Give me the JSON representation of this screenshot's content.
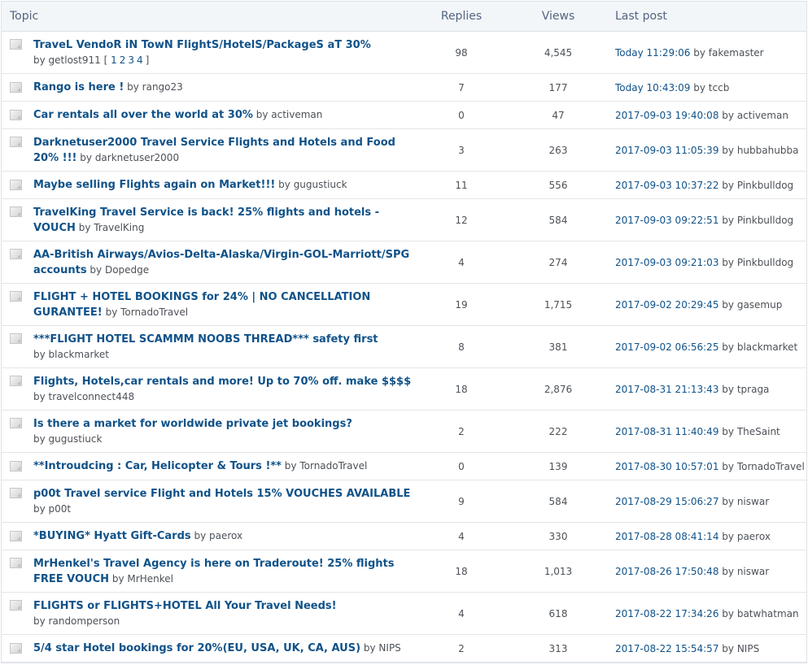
{
  "header": {
    "topic": "Topic",
    "replies": "Replies",
    "views": "Views",
    "last_post": "Last post"
  },
  "by_label": "by",
  "topics": [
    {
      "title": "TraveL VendoR iN TowN FlightS/HotelS/PackageS aT 30%",
      "title2": "",
      "author": "getlost911",
      "pages": [
        "1",
        "2",
        "3",
        "4"
      ],
      "replies": "98",
      "views": "4,545",
      "last_time": "Today 11:29:06",
      "last_user": "fakemaster"
    },
    {
      "title": "Rango is here !",
      "title2": "",
      "author": "rango23",
      "pages": [],
      "replies": "7",
      "views": "177",
      "last_time": "Today 10:43:09",
      "last_user": "tccb"
    },
    {
      "title": "Car rentals all over the world at 30%",
      "title2": "",
      "author": "activeman",
      "pages": [],
      "replies": "0",
      "views": "47",
      "last_time": "2017-09-03 19:40:08",
      "last_user": "activeman"
    },
    {
      "title": "Darknetuser2000 Travel Service Flights and Hotels and Food",
      "title2": "20% !!!",
      "author": "darknetuser2000",
      "pages": [],
      "replies": "3",
      "views": "263",
      "last_time": "2017-09-03 11:05:39",
      "last_user": "hubbahubba"
    },
    {
      "title": "Maybe selling Flights again on Market!!!",
      "title2": "",
      "author": "gugustiuck",
      "pages": [],
      "replies": "11",
      "views": "556",
      "last_time": "2017-09-03 10:37:22",
      "last_user": "Pinkbulldog"
    },
    {
      "title": "TravelKing Travel Service is back! 25% flights and hotels -",
      "title2": "VOUCH",
      "author": "TravelKing",
      "pages": [],
      "replies": "12",
      "views": "584",
      "last_time": "2017-09-03 09:22:51",
      "last_user": "Pinkbulldog"
    },
    {
      "title": "AA-British Airways/Avios-Delta-Alaska/Virgin-GOL-Marriott/SPG",
      "title2": "accounts",
      "author": "Dopedge",
      "pages": [],
      "replies": "4",
      "views": "274",
      "last_time": "2017-09-03 09:21:03",
      "last_user": "Pinkbulldog"
    },
    {
      "title": "FLIGHT + HOTEL BOOKINGS for 24% | NO CANCELLATION",
      "title2": "GURANTEE!",
      "author": "TornadoTravel",
      "pages": [],
      "replies": "19",
      "views": "1,715",
      "last_time": "2017-09-02 20:29:45",
      "last_user": "gasemup"
    },
    {
      "title": "***FLIGHT HOTEL SCAMMM NOOBS THREAD*** safety first",
      "title2": "",
      "author": "blackmarket",
      "pages": [],
      "replies": "8",
      "views": "381",
      "last_time": "2017-09-02 06:56:25",
      "last_user": "blackmarket"
    },
    {
      "title": "Flights, Hotels,car rentals and more! Up to 70% off. make $$$$",
      "title2": "",
      "author": "travelconnect448",
      "pages": [],
      "replies": "18",
      "views": "2,876",
      "last_time": "2017-08-31 21:13:43",
      "last_user": "tpraga"
    },
    {
      "title": "Is there a market for worldwide private jet bookings?",
      "title2": "",
      "author": "gugustiuck",
      "pages": [],
      "replies": "2",
      "views": "222",
      "last_time": "2017-08-31 11:40:49",
      "last_user": "TheSaint"
    },
    {
      "title": "**Introudcing : Car, Helicopter & Tours !**",
      "title2": "",
      "author": "TornadoTravel",
      "pages": [],
      "replies": "0",
      "views": "139",
      "last_time": "2017-08-30 10:57:01",
      "last_user": "TornadoTravel"
    },
    {
      "title": "p00t Travel service Flight and Hotels 15% VOUCHES AVAILABLE",
      "title2": "",
      "author": "p00t",
      "pages": [],
      "replies": "9",
      "views": "584",
      "last_time": "2017-08-29 15:06:27",
      "last_user": "niswar"
    },
    {
      "title": "*BUYING* Hyatt Gift-Cards",
      "title2": "",
      "author": "paerox",
      "pages": [],
      "replies": "4",
      "views": "330",
      "last_time": "2017-08-28 08:41:14",
      "last_user": "paerox"
    },
    {
      "title": "MrHenkel's Travel Agency is here on Traderoute! 25% flights",
      "title2": "FREE VOUCH",
      "author": "MrHenkel",
      "pages": [],
      "replies": "18",
      "views": "1,013",
      "last_time": "2017-08-26 17:50:48",
      "last_user": "niswar"
    },
    {
      "title": "FLIGHTS or FLIGHTS+HOTEL All Your Travel Needs!",
      "title2": "",
      "author": "randomperson",
      "pages": [],
      "replies": "4",
      "views": "618",
      "last_time": "2017-08-22 17:34:26",
      "last_user": "batwhatman"
    },
    {
      "title": "5/4 star Hotel bookings for 20%(EU, USA, UK, CA, AUS)",
      "title2": "",
      "author": "NIPS",
      "pages": [],
      "replies": "2",
      "views": "313",
      "last_time": "2017-08-22 15:54:57",
      "last_user": "NIPS"
    }
  ]
}
